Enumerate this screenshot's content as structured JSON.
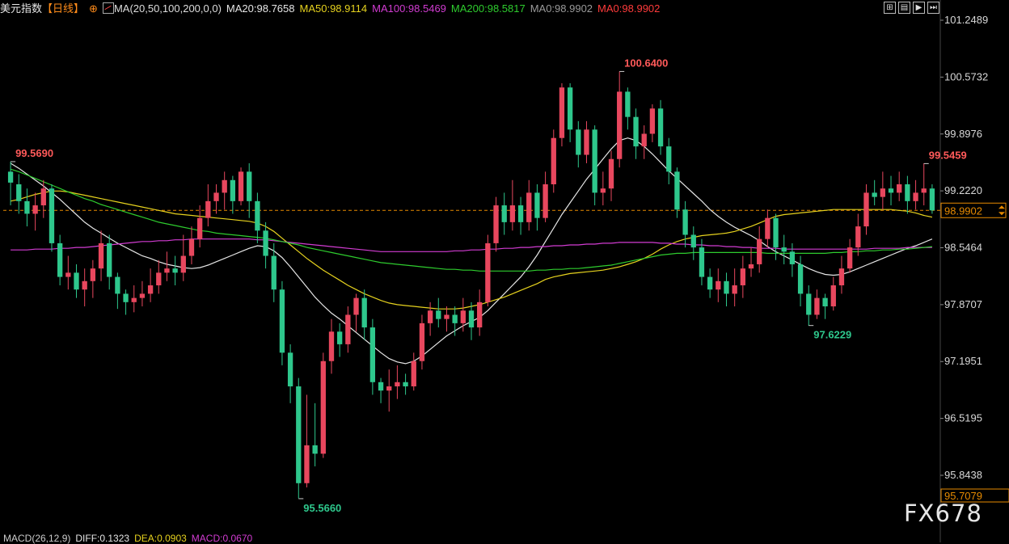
{
  "header": {
    "title": "美元指数",
    "period": "【日线】",
    "circle_icon": "⊕",
    "ma_icon": "ma-settings-icon",
    "ma_params": "MA(20,50,100,200,0,0)",
    "ma_items": [
      {
        "text": "MA20:98.7658",
        "color": "#e6e6e6"
      },
      {
        "text": "MA50:98.9114",
        "color": "#e6d21e"
      },
      {
        "text": "MA100:98.5469",
        "color": "#d23cd2"
      },
      {
        "text": "MA200:98.5817",
        "color": "#2ecc2e"
      },
      {
        "text": "MA0:98.9902",
        "color": "#9a9a9a"
      },
      {
        "text": "MA0:98.9902",
        "color": "#ff3b3b"
      }
    ]
  },
  "toolbar": {
    "buttons": [
      {
        "name": "grid-icon",
        "glyph": "⊞"
      },
      {
        "name": "layout-icon",
        "glyph": "▤"
      },
      {
        "name": "play-icon",
        "glyph": "▶"
      },
      {
        "name": "step-icon",
        "glyph": "⏭"
      }
    ]
  },
  "macd": [
    {
      "text": "MACD(26,12,9)",
      "color": "#cccccc"
    },
    {
      "text": "DIFF:0.1323",
      "color": "#e6e6e6"
    },
    {
      "text": "DEA:0.0903",
      "color": "#e6d21e"
    },
    {
      "text": "MACD:0.0670",
      "color": "#d23cd2"
    }
  ],
  "watermark": "FX678",
  "colors": {
    "up": "#e8475e",
    "down": "#2ec78c",
    "ma20": "#e6e6e6",
    "ma50": "#e6d21e",
    "ma100": "#d23cd2",
    "ma200": "#2ecc2e",
    "last_line": "#e68a00"
  },
  "chart_data": {
    "type": "candlestick",
    "title": "美元指数",
    "period": "日线",
    "y_ticks": [
      "101.2489",
      "100.5732",
      "99.8976",
      "99.2220",
      "98.5464",
      "97.8707",
      "97.1951",
      "96.5195",
      "95.8438"
    ],
    "ylim": [
      95.5,
      101.4
    ],
    "last_price": "98.9902",
    "bottom_label": "95.7079",
    "annotations": [
      {
        "text": "99.5690",
        "i": 0,
        "value": 99.569,
        "color": "#ff5a5a"
      },
      {
        "text": "95.5660",
        "i": 35,
        "value": 95.566,
        "color": "#2ec78c"
      },
      {
        "text": "100.6400",
        "i": 74,
        "value": 100.64,
        "color": "#ff5a5a"
      },
      {
        "text": "97.6229",
        "i": 97,
        "value": 97.6229,
        "color": "#2ec78c"
      },
      {
        "text": "99.5459",
        "i": 111,
        "value": 99.5459,
        "color": "#ff5a5a"
      }
    ],
    "candles": [
      [
        99.45,
        99.32,
        99.57,
        99.05
      ],
      [
        99.3,
        99.1,
        99.42,
        98.95
      ],
      [
        99.1,
        98.95,
        99.25,
        98.8
      ],
      [
        98.95,
        99.05,
        99.2,
        98.75
      ],
      [
        99.05,
        99.25,
        99.35,
        98.9
      ],
      [
        99.25,
        98.6,
        99.3,
        98.5
      ],
      [
        98.6,
        98.2,
        98.7,
        98.1
      ],
      [
        98.2,
        98.25,
        98.45,
        98.05
      ],
      [
        98.25,
        98.05,
        98.35,
        97.95
      ],
      [
        98.05,
        98.15,
        98.3,
        97.85
      ],
      [
        98.15,
        98.3,
        98.4,
        97.95
      ],
      [
        98.3,
        98.6,
        98.75,
        98.15
      ],
      [
        98.6,
        98.2,
        98.7,
        98.05
      ],
      [
        98.2,
        98.0,
        98.25,
        97.82
      ],
      [
        98.0,
        97.9,
        98.05,
        97.75
      ],
      [
        97.9,
        97.95,
        98.1,
        97.78
      ],
      [
        97.95,
        98.0,
        98.15,
        97.85
      ],
      [
        98.0,
        98.1,
        98.3,
        97.9
      ],
      [
        98.1,
        98.25,
        98.4,
        98.0
      ],
      [
        98.25,
        98.3,
        98.5,
        98.15
      ],
      [
        98.3,
        98.25,
        98.45,
        98.1
      ],
      [
        98.25,
        98.45,
        98.7,
        98.15
      ],
      [
        98.45,
        98.65,
        98.8,
        98.35
      ],
      [
        98.65,
        98.9,
        99.05,
        98.55
      ],
      [
        98.9,
        99.1,
        99.3,
        98.8
      ],
      [
        99.1,
        99.2,
        99.3,
        98.95
      ],
      [
        99.2,
        99.35,
        99.45,
        99.0
      ],
      [
        99.35,
        99.1,
        99.4,
        98.95
      ],
      [
        99.1,
        99.45,
        99.5,
        99.05
      ],
      [
        99.45,
        99.1,
        99.55,
        98.9
      ],
      [
        99.1,
        98.75,
        99.2,
        98.6
      ],
      [
        98.75,
        98.45,
        98.85,
        98.3
      ],
      [
        98.45,
        98.05,
        98.6,
        97.9
      ],
      [
        98.05,
        97.3,
        98.15,
        97.15
      ],
      [
        97.3,
        96.9,
        97.4,
        96.7
      ],
      [
        96.9,
        95.75,
        97.0,
        95.57
      ],
      [
        95.75,
        96.2,
        96.8,
        95.7
      ],
      [
        96.2,
        96.1,
        96.7,
        95.95
      ],
      [
        96.1,
        97.2,
        97.3,
        96.05
      ],
      [
        97.2,
        97.55,
        97.7,
        97.05
      ],
      [
        97.55,
        97.4,
        97.65,
        97.25
      ],
      [
        97.4,
        97.75,
        97.85,
        97.3
      ],
      [
        97.75,
        97.95,
        98.0,
        97.55
      ],
      [
        97.95,
        97.6,
        98.05,
        97.45
      ],
      [
        97.6,
        96.95,
        97.7,
        96.8
      ],
      [
        96.95,
        96.85,
        97.0,
        96.7
      ],
      [
        96.85,
        96.9,
        97.1,
        96.6
      ],
      [
        96.9,
        96.95,
        97.15,
        96.75
      ],
      [
        96.95,
        96.9,
        97.05,
        96.8
      ],
      [
        96.9,
        97.2,
        97.3,
        96.85
      ],
      [
        97.2,
        97.65,
        97.75,
        97.1
      ],
      [
        97.65,
        97.8,
        97.9,
        97.5
      ],
      [
        97.8,
        97.7,
        97.95,
        97.6
      ],
      [
        97.7,
        97.75,
        97.85,
        97.55
      ],
      [
        97.75,
        97.65,
        97.85,
        97.5
      ],
      [
        97.65,
        97.8,
        97.95,
        97.55
      ],
      [
        97.8,
        97.6,
        97.9,
        97.45
      ],
      [
        97.6,
        97.9,
        98.05,
        97.5
      ],
      [
        97.9,
        98.6,
        98.7,
        97.85
      ],
      [
        98.6,
        99.05,
        99.15,
        98.5
      ],
      [
        99.05,
        98.85,
        99.2,
        98.7
      ],
      [
        98.85,
        99.05,
        99.35,
        98.75
      ],
      [
        99.05,
        98.85,
        99.15,
        98.7
      ],
      [
        98.85,
        99.2,
        99.35,
        98.75
      ],
      [
        99.2,
        98.9,
        99.3,
        98.75
      ],
      [
        98.9,
        99.3,
        99.45,
        98.85
      ],
      [
        99.3,
        99.85,
        99.95,
        99.2
      ],
      [
        99.85,
        100.45,
        100.5,
        99.75
      ],
      [
        100.45,
        99.95,
        100.5,
        99.8
      ],
      [
        99.95,
        99.65,
        100.05,
        99.5
      ],
      [
        99.65,
        99.95,
        100.05,
        99.55
      ],
      [
        99.95,
        99.2,
        100.0,
        99.05
      ],
      [
        99.2,
        99.25,
        99.45,
        99.05
      ],
      [
        99.25,
        99.6,
        99.7,
        99.1
      ],
      [
        99.6,
        100.4,
        100.64,
        99.5
      ],
      [
        100.4,
        100.1,
        100.45,
        99.95
      ],
      [
        100.1,
        99.75,
        100.2,
        99.6
      ],
      [
        99.75,
        99.9,
        100.0,
        99.6
      ],
      [
        99.9,
        100.2,
        100.25,
        99.8
      ],
      [
        100.2,
        99.75,
        100.3,
        99.65
      ],
      [
        99.75,
        99.45,
        99.85,
        99.3
      ],
      [
        99.45,
        99.0,
        99.5,
        98.9
      ],
      [
        99.0,
        98.7,
        99.1,
        98.55
      ],
      [
        98.7,
        98.55,
        98.8,
        98.4
      ],
      [
        98.55,
        98.2,
        98.65,
        98.1
      ],
      [
        98.2,
        98.05,
        98.3,
        97.95
      ],
      [
        98.05,
        98.15,
        98.3,
        97.9
      ],
      [
        98.15,
        98.0,
        98.25,
        97.85
      ],
      [
        98.0,
        98.1,
        98.3,
        97.85
      ],
      [
        98.1,
        98.3,
        98.45,
        97.95
      ],
      [
        98.3,
        98.35,
        98.55,
        98.2
      ],
      [
        98.35,
        98.65,
        98.8,
        98.25
      ],
      [
        98.65,
        98.9,
        99.0,
        98.55
      ],
      [
        98.9,
        98.55,
        98.95,
        98.4
      ],
      [
        98.55,
        98.5,
        98.7,
        98.35
      ],
      [
        98.5,
        98.35,
        98.6,
        98.2
      ],
      [
        98.35,
        98.0,
        98.45,
        97.85
      ],
      [
        98.0,
        97.75,
        98.1,
        97.62
      ],
      [
        97.75,
        97.95,
        98.05,
        97.7
      ],
      [
        97.95,
        97.85,
        98.0,
        97.7
      ],
      [
        97.85,
        98.1,
        98.2,
        97.8
      ],
      [
        98.1,
        98.3,
        98.45,
        98.0
      ],
      [
        98.3,
        98.55,
        98.65,
        98.25
      ],
      [
        98.55,
        98.8,
        98.95,
        98.45
      ],
      [
        98.8,
        99.2,
        99.3,
        98.7
      ],
      [
        99.2,
        99.15,
        99.35,
        99.05
      ],
      [
        99.15,
        99.25,
        99.45,
        99.0
      ],
      [
        99.25,
        99.2,
        99.4,
        99.05
      ],
      [
        99.2,
        99.3,
        99.45,
        99.1
      ],
      [
        99.3,
        99.1,
        99.4,
        98.95
      ],
      [
        99.1,
        99.2,
        99.35,
        99.0
      ],
      [
        99.2,
        99.25,
        99.55,
        99.05
      ],
      [
        99.25,
        98.99,
        99.3,
        98.95
      ]
    ],
    "ma_series": [
      {
        "name": "MA20",
        "color": "#e6e6e6",
        "values": [
          99.55,
          99.49,
          99.42,
          99.35,
          99.28,
          99.2,
          99.12,
          99.03,
          98.94,
          98.85,
          98.78,
          98.72,
          98.66,
          98.6,
          98.55,
          98.5,
          98.45,
          98.42,
          98.38,
          98.35,
          98.33,
          98.31,
          98.3,
          98.31,
          98.34,
          98.38,
          98.42,
          98.46,
          98.5,
          98.54,
          98.57,
          98.56,
          98.51,
          98.43,
          98.32,
          98.2,
          98.08,
          97.96,
          97.86,
          97.77,
          97.7,
          97.62,
          97.54,
          97.46,
          97.38,
          97.3,
          97.23,
          97.19,
          97.17,
          97.2,
          97.26,
          97.34,
          97.42,
          97.5,
          97.56,
          97.62,
          97.67,
          97.72,
          97.8,
          97.9,
          98.0,
          98.1,
          98.2,
          98.32,
          98.46,
          98.62,
          98.78,
          98.94,
          99.08,
          99.22,
          99.36,
          99.48,
          99.6,
          99.72,
          99.82,
          99.85,
          99.82,
          99.75,
          99.66,
          99.56,
          99.46,
          99.37,
          99.28,
          99.19,
          99.1,
          99.0,
          98.92,
          98.85,
          98.79,
          98.74,
          98.69,
          98.63,
          98.56,
          98.5,
          98.45,
          98.4,
          98.35,
          98.3,
          98.26,
          98.23,
          98.22,
          98.23,
          98.26,
          98.3,
          98.34,
          98.38,
          98.42,
          98.46,
          98.5,
          98.54,
          98.57,
          98.61,
          98.65
        ]
      },
      {
        "name": "MA50",
        "color": "#e6d21e",
        "values": [
          99.1,
          99.12,
          99.15,
          99.18,
          99.2,
          99.22,
          99.22,
          99.21,
          99.19,
          99.17,
          99.15,
          99.13,
          99.11,
          99.09,
          99.07,
          99.05,
          99.03,
          99.01,
          98.99,
          98.97,
          98.95,
          98.94,
          98.93,
          98.92,
          98.91,
          98.9,
          98.89,
          98.88,
          98.87,
          98.86,
          98.84,
          98.8,
          98.74,
          98.66,
          98.58,
          98.5,
          98.42,
          98.35,
          98.28,
          98.22,
          98.16,
          98.1,
          98.05,
          98.0,
          97.96,
          97.92,
          97.89,
          97.87,
          97.86,
          97.85,
          97.84,
          97.83,
          97.82,
          97.82,
          97.82,
          97.83,
          97.85,
          97.87,
          97.9,
          97.93,
          97.96,
          98.0,
          98.04,
          98.08,
          98.12,
          98.17,
          98.2,
          98.22,
          98.24,
          98.25,
          98.26,
          98.27,
          98.28,
          98.3,
          98.32,
          98.35,
          98.38,
          98.42,
          98.47,
          98.53,
          98.58,
          98.62,
          98.65,
          98.67,
          98.69,
          98.7,
          98.71,
          98.72,
          98.74,
          98.77,
          98.8,
          98.84,
          98.88,
          98.92,
          98.94,
          98.95,
          98.96,
          98.97,
          98.98,
          98.99,
          99.0,
          99.0,
          99.0,
          99.0,
          99.0,
          99.0,
          99.0,
          99.0,
          98.99,
          98.98,
          98.96,
          98.93,
          98.91
        ]
      },
      {
        "name": "MA100",
        "color": "#d23cd2",
        "values": [
          98.52,
          98.52,
          98.52,
          98.53,
          98.53,
          98.53,
          98.54,
          98.54,
          98.55,
          98.55,
          98.56,
          98.57,
          98.58,
          98.59,
          98.6,
          98.61,
          98.62,
          98.62,
          98.63,
          98.63,
          98.64,
          98.64,
          98.65,
          98.65,
          98.65,
          98.65,
          98.65,
          98.65,
          98.65,
          98.65,
          98.64,
          98.64,
          98.63,
          98.62,
          98.61,
          98.6,
          98.59,
          98.58,
          98.57,
          98.56,
          98.55,
          98.54,
          98.53,
          98.52,
          98.51,
          98.5,
          98.5,
          98.5,
          98.5,
          98.5,
          98.5,
          98.5,
          98.5,
          98.5,
          98.51,
          98.51,
          98.52,
          98.52,
          98.53,
          98.53,
          98.54,
          98.54,
          98.55,
          98.55,
          98.56,
          98.56,
          98.57,
          98.57,
          98.58,
          98.58,
          98.59,
          98.59,
          98.6,
          98.6,
          98.61,
          98.61,
          98.61,
          98.61,
          98.61,
          98.6,
          98.6,
          98.59,
          98.59,
          98.58,
          98.58,
          98.57,
          98.57,
          98.56,
          98.56,
          98.55,
          98.55,
          98.54,
          98.54,
          98.54,
          98.53,
          98.53,
          98.53,
          98.53,
          98.53,
          98.53,
          98.53,
          98.53,
          98.53,
          98.53,
          98.53,
          98.54,
          98.54,
          98.54,
          98.54,
          98.55,
          98.55,
          98.55,
          98.55
        ]
      },
      {
        "name": "MA200",
        "color": "#2ecc2e",
        "values": [
          99.48,
          99.45,
          99.41,
          99.37,
          99.33,
          99.29,
          99.25,
          99.21,
          99.17,
          99.13,
          99.1,
          99.06,
          99.03,
          99.0,
          98.97,
          98.94,
          98.91,
          98.88,
          98.85,
          98.83,
          98.81,
          98.79,
          98.77,
          98.75,
          98.74,
          98.72,
          98.71,
          98.7,
          98.69,
          98.68,
          98.67,
          98.66,
          98.64,
          98.62,
          98.6,
          98.58,
          98.55,
          98.53,
          98.51,
          98.49,
          98.47,
          98.45,
          98.43,
          98.41,
          98.39,
          98.37,
          98.36,
          98.35,
          98.34,
          98.33,
          98.32,
          98.31,
          98.3,
          98.29,
          98.29,
          98.28,
          98.28,
          98.27,
          98.27,
          98.27,
          98.27,
          98.27,
          98.27,
          98.27,
          98.28,
          98.28,
          98.29,
          98.29,
          98.3,
          98.3,
          98.31,
          98.32,
          98.33,
          98.34,
          98.36,
          98.38,
          98.4,
          98.42,
          98.44,
          98.46,
          98.47,
          98.48,
          98.48,
          98.49,
          98.49,
          98.49,
          98.49,
          98.49,
          98.49,
          98.49,
          98.49,
          98.49,
          98.48,
          98.48,
          98.48,
          98.48,
          98.48,
          98.48,
          98.48,
          98.48,
          98.49,
          98.49,
          98.5,
          98.5,
          98.51,
          98.51,
          98.52,
          98.52,
          98.53,
          98.53,
          98.54,
          98.55,
          98.56
        ]
      }
    ]
  }
}
